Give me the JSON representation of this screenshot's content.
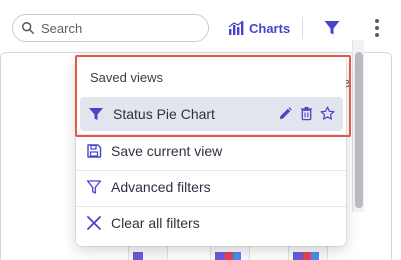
{
  "toolbar": {
    "search": {
      "placeholder": "Search",
      "icon": "search-icon"
    },
    "charts_label": "Charts",
    "filter_icon": "funnel-icon",
    "more_icon": "kebab-menu-icon"
  },
  "panel": {
    "header_partial": "e"
  },
  "dropdown": {
    "section_title": "Saved views",
    "saved_views": [
      {
        "label": "Status Pie Chart",
        "icon": "funnel-filled-icon",
        "actions": [
          "edit-icon",
          "delete-icon",
          "star-icon"
        ]
      }
    ],
    "items": [
      {
        "label": "Save current view",
        "icon": "floppy-disk-icon"
      },
      {
        "label": "Advanced filters",
        "icon": "funnel-outline-icon"
      },
      {
        "label": "Clear all filters",
        "icon": "close-icon"
      }
    ]
  },
  "colors": {
    "accent": "#4a43c9",
    "highlight": "#e05a47",
    "selected_bg": "#e3e5ee"
  }
}
